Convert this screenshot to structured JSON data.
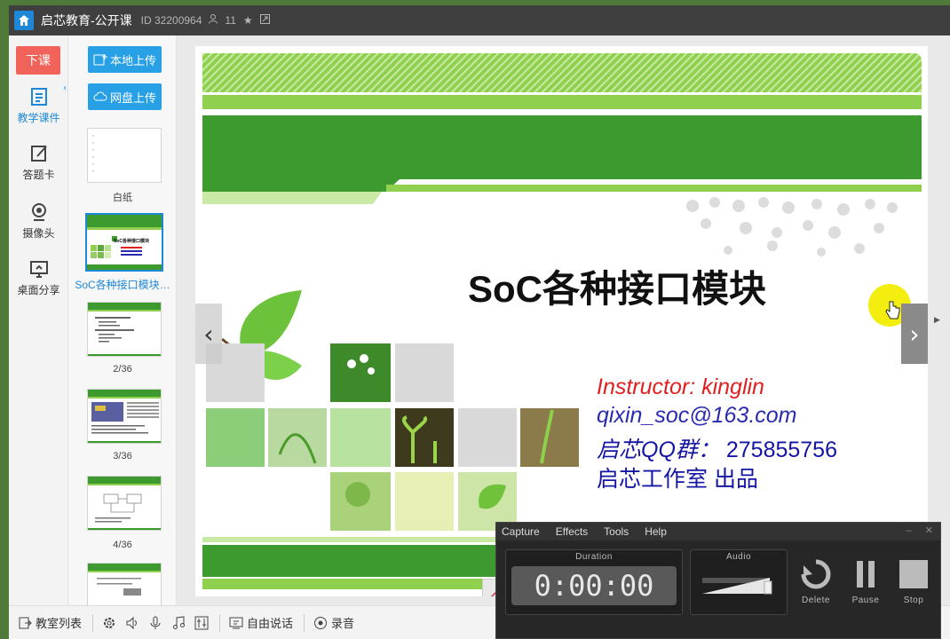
{
  "titlebar": {
    "title": "启芯教育-公开课",
    "room_id": "ID 32200964",
    "user_count": "11",
    "icons": [
      "home-icon",
      "user-icon",
      "star-icon",
      "share-icon"
    ]
  },
  "leftnav": {
    "end_class_label": "下课",
    "items": [
      {
        "label": "教学课件",
        "icon": "courseware-icon",
        "active": true
      },
      {
        "label": "答题卡",
        "icon": "answer-card-icon",
        "active": false
      },
      {
        "label": "摄像头",
        "icon": "camera-icon",
        "active": false
      },
      {
        "label": "桌面分享",
        "icon": "screen-share-icon",
        "active": false
      }
    ],
    "collapse_glyph": "‹"
  },
  "slides": {
    "local_upload_label": "本地上传",
    "cloud_upload_label": "网盘上传",
    "thumbnails": [
      {
        "label": "白纸",
        "active": false
      },
      {
        "label": "SoC各种接口模块…",
        "active": true
      },
      {
        "label": "2/36",
        "active": false
      },
      {
        "label": "3/36",
        "active": false
      },
      {
        "label": "4/36",
        "active": false
      }
    ]
  },
  "slide": {
    "title": "SoC各种接口模块",
    "instructor": "Instructor: kinglin",
    "email": "qixin_soc@163.com",
    "qq_label": "启芯QQ群：",
    "qq_number": "275855756",
    "studio": "启芯工作室 出品",
    "prev_glyph": "‹",
    "next_glyph": "›"
  },
  "bottombar": {
    "class_list_label": "教室列表",
    "free_talk_label": "自由说话",
    "record_label": "录音"
  },
  "recorder": {
    "menu": [
      "Capture",
      "Effects",
      "Tools",
      "Help"
    ],
    "duration_label": "Duration",
    "time": "0:00:00",
    "audio_label": "Audio",
    "delete_label": "Delete",
    "pause_label": "Pause",
    "stop_label": "Stop"
  },
  "colors": {
    "accent_blue": "#1e88d8",
    "end_class_red": "#f0625a",
    "slide_green": "#3c9a2e",
    "instructor_red": "#e02020",
    "contact_blue": "#1515a5"
  }
}
